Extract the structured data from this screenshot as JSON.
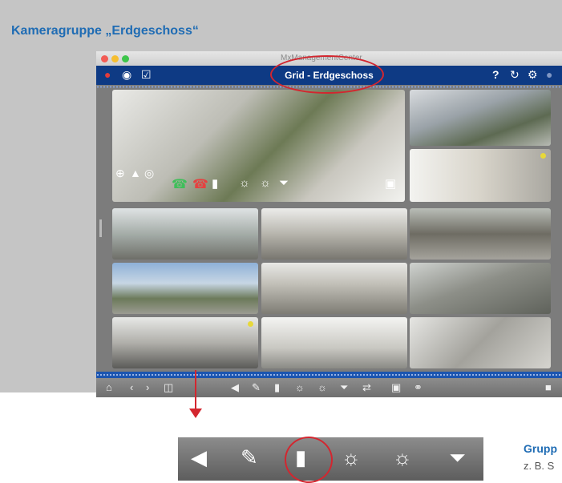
{
  "heading": "Kameragruppe „Erdgeschoss“",
  "app": {
    "window_title": "MxManagementCenter",
    "view_title": "Grid - Erdgeschoss",
    "nav_right_icons": [
      "help-icon",
      "refresh-icon",
      "settings-icon"
    ],
    "nav_left_icons": [
      "user-alarm-icon",
      "chat-icon",
      "checkbox-icon"
    ]
  },
  "toolbar": {
    "left_icons": [
      "home-icon",
      "prev-icon",
      "next-icon",
      "layout-icon"
    ],
    "center_icons": [
      "speaker-icon",
      "microphone-icon",
      "door-icon",
      "light-on-icon",
      "light-off-icon",
      "thermometer-icon",
      "switch-icon",
      "snapshot-icon",
      "link-icon"
    ],
    "right_icons": [
      "lock-icon"
    ]
  },
  "zoom_toolbar": {
    "icons": [
      "speaker-icon",
      "microphone-icon",
      "door-icon",
      "light-on-icon",
      "light-off-icon",
      "thermometer-icon"
    ]
  },
  "side": {
    "title": "Grupp",
    "text": "z. B. S"
  },
  "colors": {
    "accent": "#1f6cb4",
    "navbar": "#0e3a84",
    "highlight": "#d3262f"
  }
}
